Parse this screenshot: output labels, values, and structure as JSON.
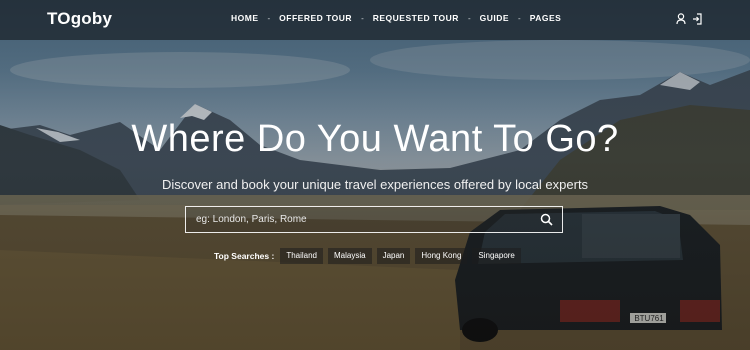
{
  "navbar": {
    "logo": "TOgoby",
    "items": [
      {
        "label": "HOME"
      },
      {
        "label": "OFFERED TOUR"
      },
      {
        "label": "REQUESTED TOUR"
      },
      {
        "label": "GUIDE"
      },
      {
        "label": "PAGES"
      }
    ],
    "separator": "-",
    "icons": [
      "user-icon",
      "sign-in-icon"
    ]
  },
  "hero": {
    "title": "Where Do You Want To Go?",
    "subtitle": "Discover and book your unique travel experiences offered by local experts"
  },
  "search": {
    "placeholder": "eg: London, Paris, Rome",
    "icon": "search-icon"
  },
  "top_searches": {
    "label": "Top Searches :",
    "tags": [
      "Thailand",
      "Malaysia",
      "Japan",
      "Hong Kong",
      "Singapore"
    ]
  },
  "scene": {
    "van_plate": "BTU761"
  }
}
